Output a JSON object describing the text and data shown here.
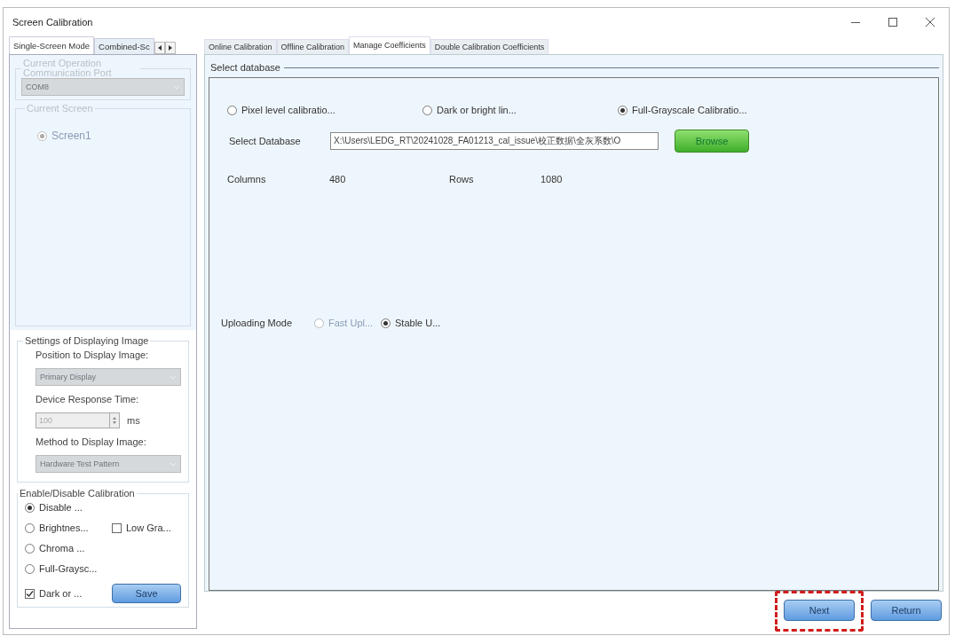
{
  "window": {
    "title": "Screen Calibration"
  },
  "left_tabs": [
    {
      "label": "Single-Screen Mode",
      "selected": true
    },
    {
      "label": "Combined-Sc",
      "selected": false
    }
  ],
  "communication": {
    "legend": "Current Operation Communication Port",
    "value": "COM8",
    "disabled": true
  },
  "current_screen": {
    "legend": "Current Screen",
    "screens": [
      {
        "label": "Screen1",
        "selected": true,
        "disabled": true
      }
    ]
  },
  "display_settings": {
    "legend": "Settings of Displaying Image",
    "position_label": "Position to Display Image:",
    "position_value": "Primary Display",
    "response_label": "Device Response Time:",
    "response_value": "100",
    "response_unit": "ms",
    "method_label": "Method to Display Image:",
    "method_value": "Hardware Test Pattern"
  },
  "calibration_toggle": {
    "legend": "Enable/Disable Calibration",
    "rows": [
      [
        {
          "kind": "radio",
          "label": "Disable ...",
          "checked": true
        }
      ],
      [
        {
          "kind": "radio",
          "label": "Brightnes...",
          "checked": false
        },
        {
          "kind": "checkbox",
          "label": "Low Gra...",
          "checked": false
        }
      ],
      [
        {
          "kind": "radio",
          "label": "Chroma ...",
          "checked": false
        }
      ],
      [
        {
          "kind": "radio",
          "label": "Full-Graysc...",
          "checked": false
        }
      ],
      [
        {
          "kind": "checkbox",
          "label": "Dark or ...",
          "checked": true
        },
        {
          "kind": "button",
          "label": "Save"
        }
      ]
    ]
  },
  "tabs": [
    {
      "label": "Online Calibration",
      "selected": false
    },
    {
      "label": "Offline Calibration",
      "selected": false
    },
    {
      "label": "Manage Coefficients",
      "selected": true
    },
    {
      "label": "Double Calibration Coefficients",
      "selected": false
    }
  ],
  "database": {
    "legend": "Select database",
    "types": [
      {
        "label": "Pixel level calibratio...",
        "selected": false
      },
      {
        "label": "Dark or bright lin...",
        "selected": false
      },
      {
        "label": "Full-Grayscale Calibratio...",
        "selected": true
      }
    ],
    "path_label": "Select Database",
    "path_value": "X:\\Users\\LEDG_RT\\20241028_FA01213_cal_issue\\校正数据\\全灰系数\\O",
    "browse_button": "Browse",
    "columns_label": "Columns",
    "columns_value": "480",
    "rows_label": "Rows",
    "rows_value": "1080",
    "upload_label": "Uploading Mode",
    "upload_modes": [
      {
        "label": "Fast Upl...",
        "selected": false,
        "disabled": true
      },
      {
        "label": "Stable U...",
        "selected": true,
        "disabled": false
      }
    ]
  },
  "footer_buttons": [
    {
      "label": "Next",
      "highlighted": true
    },
    {
      "label": "Return",
      "highlighted": false
    }
  ]
}
